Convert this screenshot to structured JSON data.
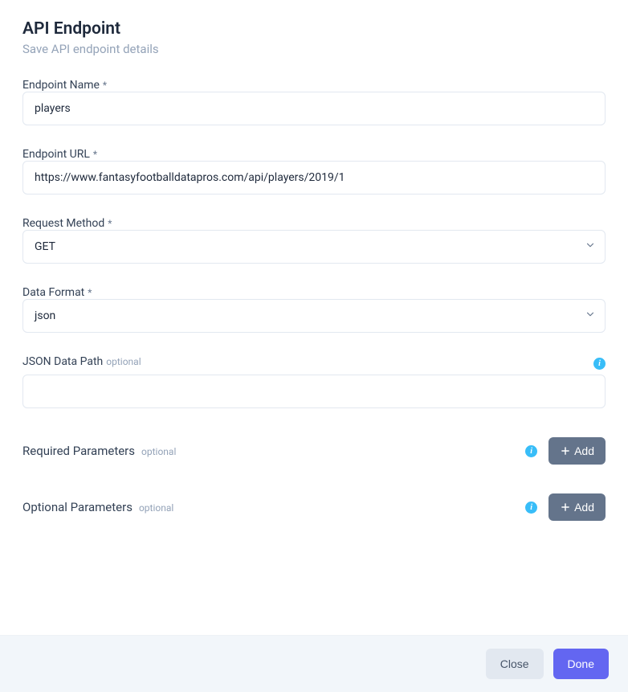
{
  "header": {
    "title": "API Endpoint",
    "subtitle": "Save API endpoint details"
  },
  "fields": {
    "endpoint_name": {
      "label": "Endpoint Name",
      "required_marker": "*",
      "value": "players"
    },
    "endpoint_url": {
      "label": "Endpoint URL",
      "required_marker": "*",
      "value": "https://www.fantasyfootballdatapros.com/api/players/2019/1"
    },
    "request_method": {
      "label": "Request Method",
      "required_marker": "*",
      "value": "GET"
    },
    "data_format": {
      "label": "Data Format",
      "required_marker": "*",
      "value": "json"
    },
    "json_data_path": {
      "label": "JSON Data Path",
      "optional_text": "optional",
      "value": ""
    }
  },
  "sections": {
    "required_params": {
      "label": "Required Parameters",
      "optional_text": "optional",
      "add_button": "Add"
    },
    "optional_params": {
      "label": "Optional Parameters",
      "optional_text": "optional",
      "add_button": "Add"
    }
  },
  "footer": {
    "close": "Close",
    "done": "Done"
  },
  "glyphs": {
    "info": "i"
  }
}
